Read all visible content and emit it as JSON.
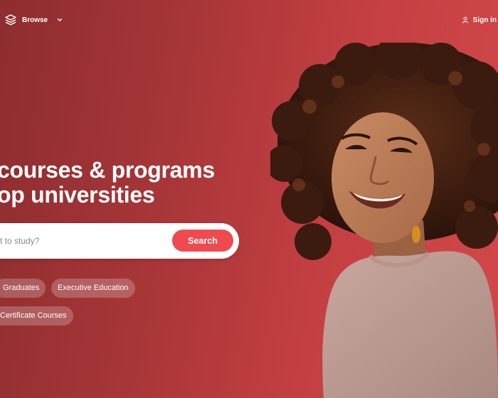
{
  "nav": {
    "logo_icon": "stack-layers-icon",
    "browse_label": "Browse",
    "browse_icon": "chevron-down-icon",
    "signin_label": "Sign in",
    "signin_icon": "user-icon"
  },
  "hero": {
    "headline_line1": "courses & programs",
    "headline_line2": "op universities",
    "search": {
      "placeholder": "t to study?",
      "button_label": "Search"
    },
    "chips": [
      {
        "label": "Graduates"
      },
      {
        "label": "Executive Education"
      },
      {
        "label": "Certificate Courses"
      }
    ],
    "colors": {
      "background_start": "#8d2d2f",
      "background_end": "#d2484a",
      "accent": "#ef4a50"
    }
  }
}
